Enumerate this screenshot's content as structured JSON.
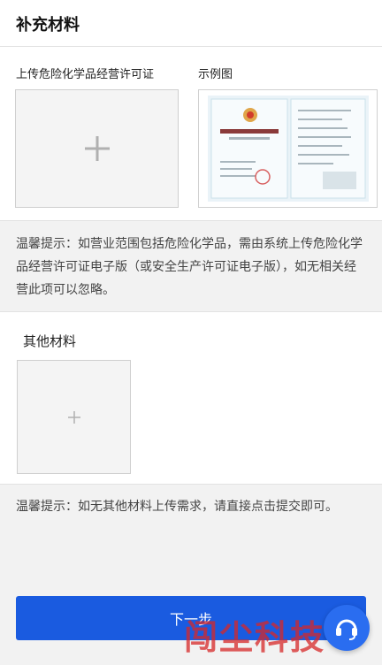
{
  "header": {
    "title": "补充材料"
  },
  "license_section": {
    "upload_label": "上传危险化学品经营许可证",
    "sample_label": "示例图"
  },
  "tip1": "温馨提示：如营业范围包括危险化学品，需由系统上传危险化学品经营许可证电子版（或安全生产许可证电子版），如无相关经营此项可以忽略。",
  "other_section": {
    "label": "其他材料"
  },
  "tip2": "温馨提示：如无其他材料上传需求，请直接点击提交即可。",
  "next_button": {
    "label": "下一步"
  },
  "watermark": "闯尘科技",
  "colors": {
    "primary": "#1a5be0",
    "watermark": "#d62828",
    "support": "#2a6df0"
  },
  "icons": {
    "upload": "plus-icon",
    "support": "customer-service-icon"
  }
}
